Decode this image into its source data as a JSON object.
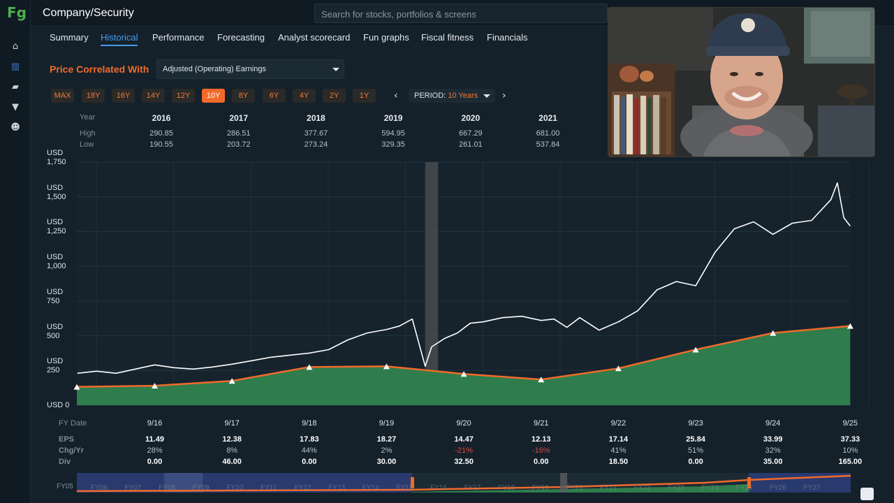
{
  "app": {
    "title": "Company/Security",
    "logo": "Fg"
  },
  "search": {
    "placeholder": "Search for stocks, portfolios & screens"
  },
  "sidebar": {
    "icons": [
      "home-icon",
      "chart-icon",
      "briefcase-icon",
      "filter-icon",
      "users-icon"
    ],
    "active": "chart-icon"
  },
  "tabs": [
    {
      "label": "Summary",
      "active": false
    },
    {
      "label": "Historical",
      "active": true
    },
    {
      "label": "Performance",
      "active": false
    },
    {
      "label": "Forecasting",
      "active": false
    },
    {
      "label": "Analyst scorecard",
      "active": false
    },
    {
      "label": "Fun graphs",
      "active": false
    },
    {
      "label": "Fiscal fitness",
      "active": false
    },
    {
      "label": "Financials",
      "active": false
    }
  ],
  "correlation": {
    "label": "Price Correlated With",
    "selected": "Adjusted (Operating) Earnings"
  },
  "ranges": [
    {
      "label": "MAX",
      "active": false
    },
    {
      "label": "18Y",
      "active": false
    },
    {
      "label": "16Y",
      "active": false
    },
    {
      "label": "14Y",
      "active": false
    },
    {
      "label": "12Y",
      "active": false
    },
    {
      "label": "10Y",
      "active": true
    },
    {
      "label": "8Y",
      "active": false
    },
    {
      "label": "6Y",
      "active": false
    },
    {
      "label": "4Y",
      "active": false
    },
    {
      "label": "2Y",
      "active": false
    },
    {
      "label": "1Y",
      "active": false
    }
  ],
  "period": {
    "label": "PERIOD:",
    "value": "10 Years"
  },
  "year_table": {
    "labels": {
      "year": "Year",
      "high": "High",
      "low": "Low"
    },
    "rows": [
      {
        "year": "2016",
        "high": "290.85",
        "low": "190.55"
      },
      {
        "year": "2017",
        "high": "286.51",
        "low": "203.72"
      },
      {
        "year": "2018",
        "high": "377.67",
        "low": "273.24"
      },
      {
        "year": "2019",
        "high": "594.95",
        "low": "329.35"
      },
      {
        "year": "2020",
        "high": "667.29",
        "low": "261.01"
      },
      {
        "year": "2021",
        "high": "681.00",
        "low": "537.84"
      }
    ]
  },
  "fiscal_labels": {
    "date": "FY Date",
    "eps": "EPS",
    "chg": "Chg/Yr",
    "div": "Div"
  },
  "fiscal": [
    {
      "date": "9/16",
      "eps": "11.49",
      "chg": "28%",
      "div": "0.00",
      "neg": false
    },
    {
      "date": "9/17",
      "eps": "12.38",
      "chg": "8%",
      "div": "46.00",
      "neg": false
    },
    {
      "date": "9/18",
      "eps": "17.83",
      "chg": "44%",
      "div": "0.00",
      "neg": false
    },
    {
      "date": "9/19",
      "eps": "18.27",
      "chg": "2%",
      "div": "30.00",
      "neg": false
    },
    {
      "date": "9/20",
      "eps": "14.47",
      "chg": "-21%",
      "div": "32.50",
      "neg": true
    },
    {
      "date": "9/21",
      "eps": "12.13",
      "chg": "-16%",
      "div": "0.00",
      "neg": true
    },
    {
      "date": "9/22",
      "eps": "17.14",
      "chg": "41%",
      "div": "18.50",
      "neg": false
    },
    {
      "date": "9/23",
      "eps": "25.84",
      "chg": "51%",
      "div": "0.00",
      "neg": false
    },
    {
      "date": "9/24",
      "eps": "33.99",
      "chg": "32%",
      "div": "35.00",
      "neg": false
    },
    {
      "date": "9/25",
      "eps": "37.33",
      "chg": "10%",
      "div": "165.00",
      "neg": false
    }
  ],
  "scroller": {
    "first_label": "FY05",
    "labels": [
      "FY06",
      "FY07",
      "FY08",
      "FY09",
      "FY10",
      "FY11",
      "FY12",
      "FY13",
      "FY14",
      "FY15",
      "FY16",
      "FY17",
      "FY18",
      "FY19",
      "FY20",
      "FY21",
      "FY22",
      "FY23",
      "FY24",
      "FY25",
      "FY26",
      "FY27"
    ]
  },
  "chart_data": {
    "type": "line",
    "y_axis_labels": [
      {
        "value": 0,
        "label": "USD 0"
      },
      {
        "value": 250,
        "label": "USD 250"
      },
      {
        "value": 500,
        "label": "USD 500"
      },
      {
        "value": 750,
        "label": "USD 750"
      },
      {
        "value": 1000,
        "label": "USD 1,000"
      },
      {
        "value": 1250,
        "label": "USD 1,250"
      },
      {
        "value": 1500,
        "label": "USD 1,500"
      },
      {
        "value": 1750,
        "label": "USD 1,750"
      }
    ],
    "ylim": [
      0,
      1750
    ],
    "x_categories": [
      "9/16",
      "9/17",
      "9/18",
      "9/19",
      "9/20",
      "9/21",
      "9/22",
      "9/23",
      "9/24",
      "9/25"
    ],
    "recession_band": {
      "from": "3/20",
      "to": "5/20"
    },
    "series": [
      {
        "kind": "earnings",
        "values": [
          140,
          175,
          275,
          280,
          225,
          185,
          265,
          400,
          520,
          570
        ]
      },
      {
        "kind": "price",
        "points": [
          [
            "9/15",
            230
          ],
          [
            "12/15",
            245
          ],
          [
            "3/16",
            230
          ],
          [
            "6/16",
            260
          ],
          [
            "9/16",
            290
          ],
          [
            "12/16",
            270
          ],
          [
            "3/17",
            260
          ],
          [
            "6/17",
            275
          ],
          [
            "9/17",
            295
          ],
          [
            "12/17",
            320
          ],
          [
            "3/18",
            345
          ],
          [
            "6/18",
            360
          ],
          [
            "9/18",
            375
          ],
          [
            "12/18",
            400
          ],
          [
            "3/19",
            470
          ],
          [
            "6/19",
            520
          ],
          [
            "9/19",
            545
          ],
          [
            "11/19",
            570
          ],
          [
            "1/20",
            620
          ],
          [
            "3/20",
            280
          ],
          [
            "4/20",
            420
          ],
          [
            "6/20",
            480
          ],
          [
            "8/20",
            520
          ],
          [
            "10/20",
            590
          ],
          [
            "12/20",
            600
          ],
          [
            "3/21",
            630
          ],
          [
            "6/21",
            640
          ],
          [
            "9/21",
            610
          ],
          [
            "11/21",
            620
          ],
          [
            "1/22",
            560
          ],
          [
            "3/22",
            630
          ],
          [
            "6/22",
            540
          ],
          [
            "9/22",
            600
          ],
          [
            "12/22",
            680
          ],
          [
            "3/23",
            830
          ],
          [
            "6/23",
            890
          ],
          [
            "9/23",
            860
          ],
          [
            "12/23",
            1100
          ],
          [
            "3/24",
            1270
          ],
          [
            "6/24",
            1320
          ],
          [
            "9/24",
            1230
          ],
          [
            "12/24",
            1310
          ],
          [
            "3/25",
            1330
          ],
          [
            "6/25",
            1480
          ],
          [
            "7/25",
            1600
          ],
          [
            "8/25",
            1350
          ],
          [
            "9/25",
            1290
          ]
        ]
      }
    ]
  }
}
